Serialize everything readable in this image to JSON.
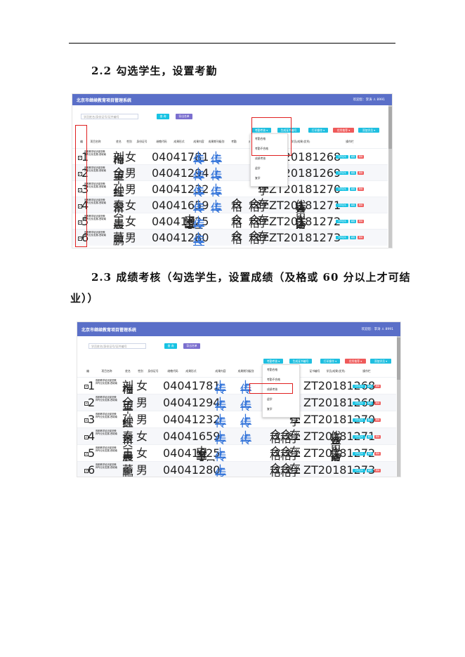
{
  "headings": {
    "h22": "2.2 勾选学生，设置考勤",
    "h23_line1": "2.3 成绩考核（勾选学生，设置成绩（及格或 60 分以上才可结",
    "h23_line2": "业））"
  },
  "app": {
    "title": "北京市继续教育项目管理系统",
    "user": "欢迎您：李涛",
    "account": "♙ 8991",
    "search_placeholder": "学员姓名/身份证号/证件编号",
    "search_btn": "查 询",
    "export_btn": "导出名单",
    "toolbar": {
      "attendance": "考勤考核 ▾",
      "generate_cert": "生成证书编号",
      "print": "打印操作 ▾",
      "excellent": "优秀推荐 ▾",
      "add_student": "添加学员 ▾"
    },
    "dropdown_items": [
      "考勤合格",
      "考勤不合格",
      "成绩考核",
      "退学",
      "复学"
    ],
    "columns": [
      "编",
      "项目名称",
      "姓名",
      "性别",
      "身份证号",
      "继教代码",
      "成果形式",
      "成果内容",
      "成果期刊级别",
      "考勤",
      "成绩",
      "状态",
      "证书编号",
      "学员/成果(优秀)",
      "操作栏"
    ],
    "rows": [
      {
        "num": "1",
        "project": "首都教学培训促进教师专业化发展-西城南",
        "name": "刘梅瑾",
        "gender": "女",
        "code": "04041781",
        "form": "",
        "upload1": "上传",
        "upload2": "上传",
        "att": "",
        "grade": "",
        "status": "",
        "cert": "ZT20181268",
        "excellent": ""
      },
      {
        "num": "2",
        "project": "首都教学培训促进教师专业化发展-西城南",
        "name": "全望平",
        "gender": "男",
        "code": "04041294",
        "form": "",
        "upload1": "上传",
        "upload2": "上传",
        "att": "",
        "grade": "",
        "status": "在学",
        "cert": "ZT20181269",
        "excellent": ""
      },
      {
        "num": "3",
        "project": "首都教学培训促进教师专业化发展-西城南",
        "name": "孙红霞",
        "gender": "男",
        "code": "04041232",
        "form": "",
        "upload1": "上传",
        "upload2": "上传",
        "att": "",
        "grade": "",
        "status": "在学",
        "cert": "ZT20181270",
        "excellent": ""
      },
      {
        "num": "4",
        "project": "首都教学培训促进教师专业化发展-西城南",
        "name": "秦翠贝",
        "gender": "女",
        "code": "04041659",
        "form": "",
        "upload1": "上传",
        "upload2": "上传",
        "att": "合格",
        "grade": "合格",
        "status": "在学",
        "cert": "ZT20181271",
        "excellent": "优秀学员"
      },
      {
        "num": "5",
        "project": "首都教学培训促进教师专业化发展-西城南",
        "name": "王晨嘉",
        "gender": "女",
        "code": "04041625",
        "form": "中学美术（日照）",
        "upload1": "上传",
        "upload2": "",
        "att": "合格",
        "grade": "合格",
        "status": "在学",
        "cert": "ZT20181272",
        "excellent": "优秀成果"
      },
      {
        "num": "6",
        "project": "首都教学培训促进教师专业化发展-西城南",
        "name": "董鹏",
        "gender": "男",
        "code": "04041280",
        "form": "",
        "upload1": "上传",
        "upload2": "",
        "att": "合格",
        "grade": "合格",
        "status": "在学",
        "cert": "ZT20181273",
        "excellent": ""
      }
    ],
    "row_actions": [
      "打印证书",
      "编辑",
      "删除"
    ],
    "footer_url": "javascript:void(0)"
  },
  "colors": {
    "topbar": "#5a6fc8",
    "cyan_button": "#17c3e3",
    "red_highlight": "#e02020"
  }
}
